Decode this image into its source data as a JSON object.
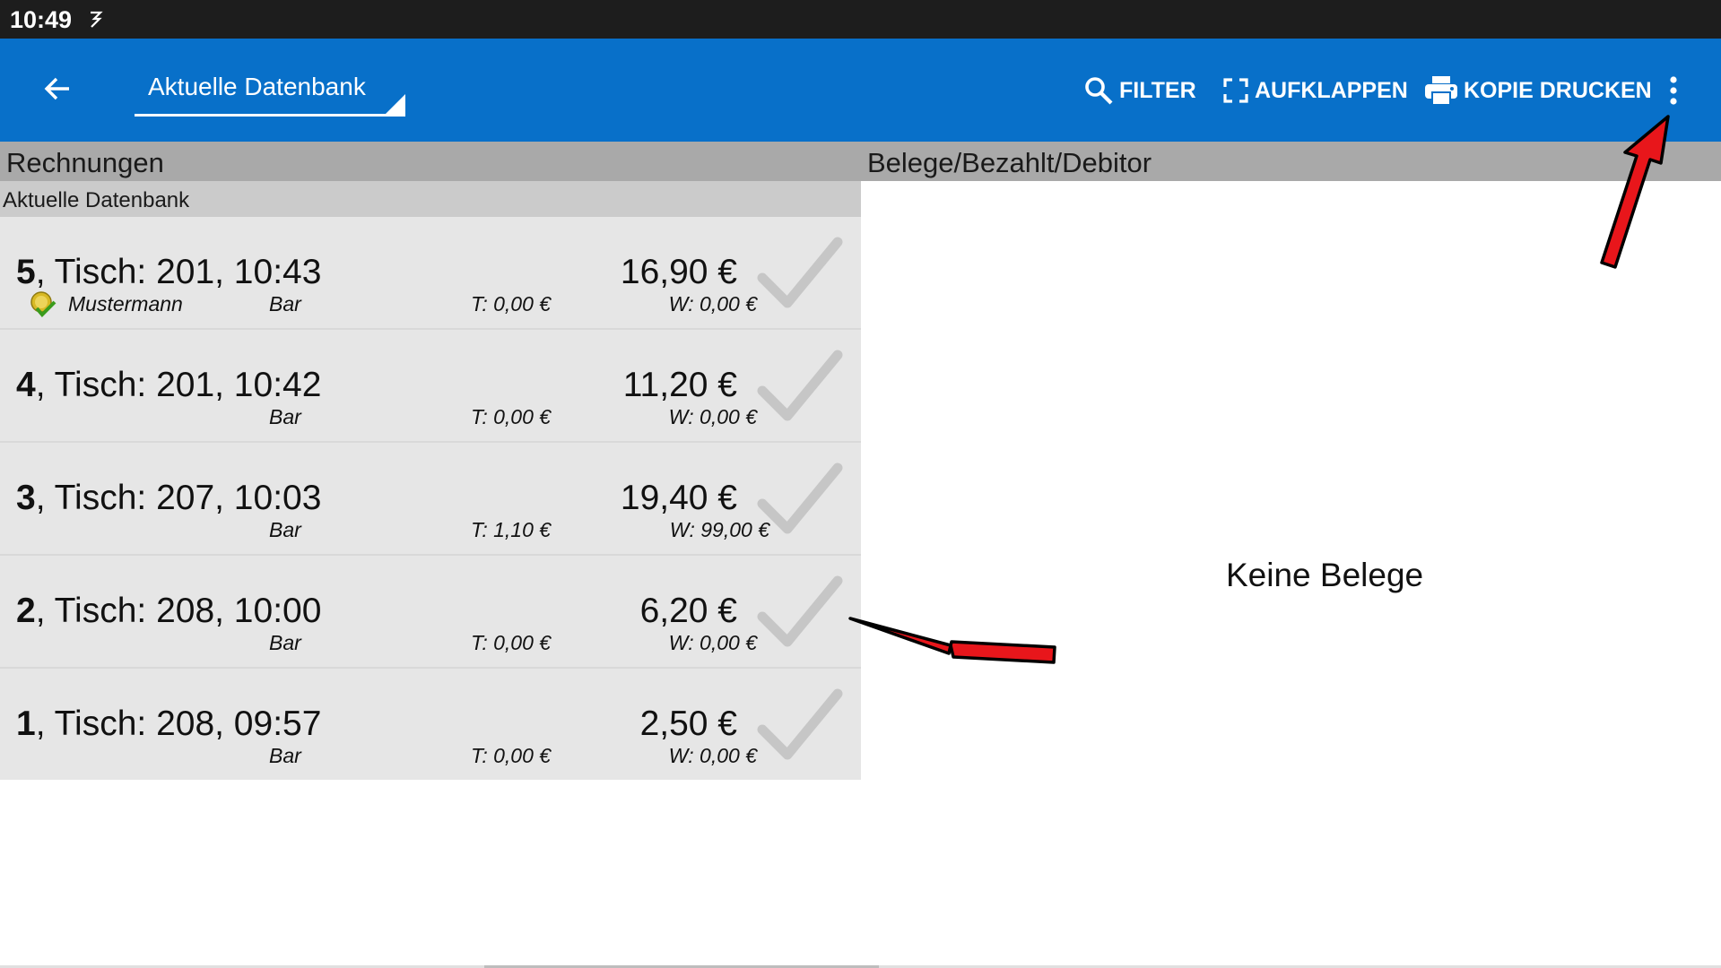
{
  "status_bar": {
    "time": "10:49",
    "notification_icon": "sync-icon"
  },
  "toolbar": {
    "back_icon": "arrow-left-icon",
    "database_spinner_value": "Aktuelle Datenbank",
    "actions": [
      {
        "label": "FILTER",
        "icon": "search-icon"
      },
      {
        "label": "AUFKLAPPEN",
        "icon": "expand-icon"
      },
      {
        "label": "KOPIE DRUCKEN",
        "icon": "printer-icon"
      }
    ],
    "overflow_icon": "more-vertical-icon"
  },
  "left_pane": {
    "header": "Rechnungen",
    "subheader": "Aktuelle Datenbank",
    "invoices": [
      {
        "number": "5",
        "title_rest": ", Tisch: 201, 10:43",
        "amount": "16,90 €",
        "customer": "Mustermann",
        "payment": "Bar",
        "tip": "T: 0,00 €",
        "received": "W: 0,00 €",
        "has_customer_icon": true
      },
      {
        "number": "4",
        "title_rest": ", Tisch: 201, 10:42",
        "amount": "11,20 €",
        "customer": "",
        "payment": "Bar",
        "tip": "T: 0,00 €",
        "received": "W: 0,00 €",
        "has_customer_icon": false
      },
      {
        "number": "3",
        "title_rest": ", Tisch: 207, 10:03",
        "amount": "19,40 €",
        "customer": "",
        "payment": "Bar",
        "tip": "T: 1,10 €",
        "received": "W: 99,00 €",
        "has_customer_icon": false
      },
      {
        "number": "2",
        "title_rest": ", Tisch: 208, 10:00",
        "amount": "6,20 €",
        "customer": "",
        "payment": "Bar",
        "tip": "T: 0,00 €",
        "received": "W: 0,00 €",
        "has_customer_icon": false
      },
      {
        "number": "1",
        "title_rest": ", Tisch: 208, 09:57",
        "amount": "2,50 €",
        "customer": "",
        "payment": "Bar",
        "tip": "T: 0,00 €",
        "received": "W: 0,00 €",
        "has_customer_icon": false
      }
    ]
  },
  "right_pane": {
    "header": "Belege/Bezahlt/Debitor",
    "empty_message": "Keine Belege"
  },
  "colors": {
    "toolbar": "#0870c9",
    "status_bar": "#1d1d1d",
    "section_header": "#a9a9a9",
    "list_background": "#e6e6e6",
    "annotation_arrow": "#e8161b"
  }
}
